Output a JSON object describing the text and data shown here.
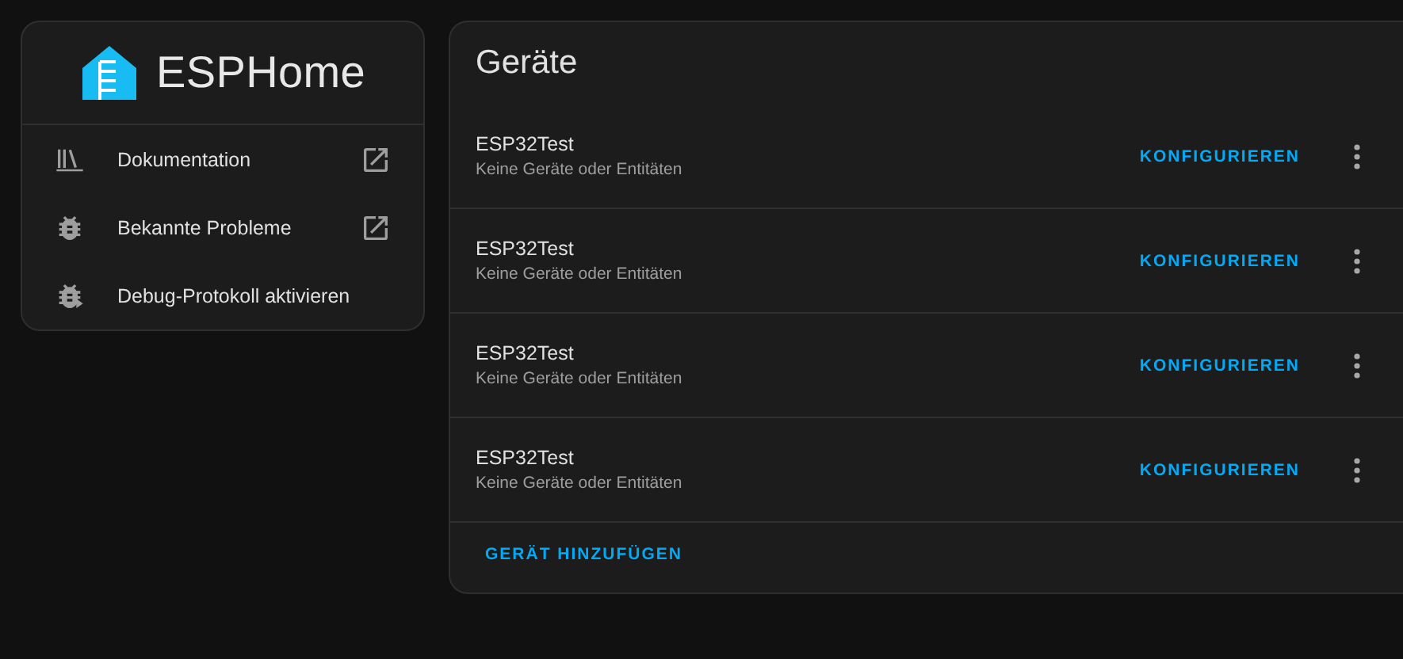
{
  "logo": {
    "title": "ESPHome"
  },
  "sidebar": {
    "items": [
      {
        "kind": "library",
        "label": "Dokumentation",
        "external": true
      },
      {
        "kind": "bug",
        "label": "Bekannte Probleme",
        "external": true
      },
      {
        "kind": "bug-play",
        "label": "Debug-Protokoll aktivieren",
        "external": false
      }
    ]
  },
  "devices": {
    "title": "Geräte",
    "rows": [
      {
        "name": "ESP32Test",
        "subtitle": "Keine Geräte oder Entitäten",
        "action": "KONFIGURIEREN"
      },
      {
        "name": "ESP32Test",
        "subtitle": "Keine Geräte oder Entitäten",
        "action": "KONFIGURIEREN"
      },
      {
        "name": "ESP32Test",
        "subtitle": "Keine Geräte oder Entitäten",
        "action": "KONFIGURIEREN"
      },
      {
        "name": "ESP32Test",
        "subtitle": "Keine Geräte oder Entitäten",
        "action": "KONFIGURIEREN"
      }
    ],
    "footer_button": "GERÄT HINZUFÜGEN"
  }
}
